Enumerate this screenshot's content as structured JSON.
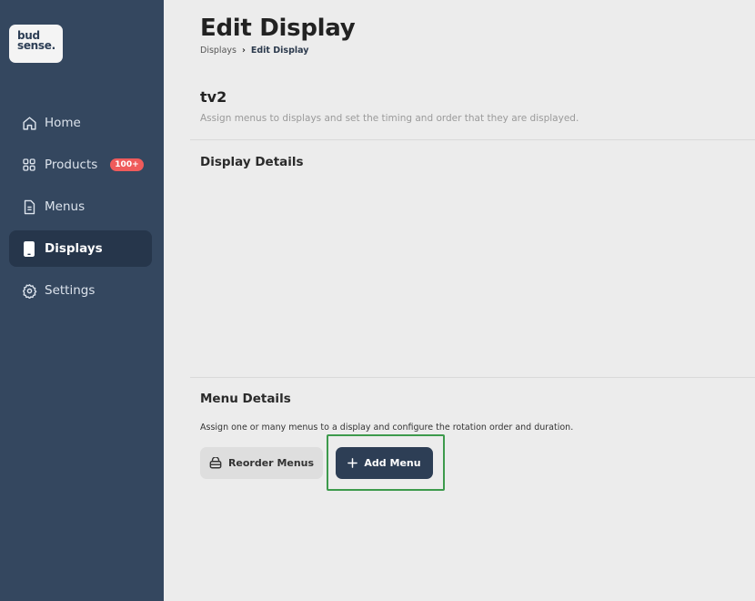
{
  "logo": {
    "line1": "bud",
    "line2": "sense."
  },
  "sidebar": {
    "items": [
      {
        "label": "Home",
        "icon": "home-icon"
      },
      {
        "label": "Products",
        "icon": "grid-icon",
        "badge": "100+"
      },
      {
        "label": "Menus",
        "icon": "document-icon"
      },
      {
        "label": "Displays",
        "icon": "display-icon",
        "active": true
      },
      {
        "label": "Settings",
        "icon": "gear-icon"
      }
    ]
  },
  "header": {
    "title": "Edit Display",
    "breadcrumb": {
      "parent": "Displays",
      "separator": "›",
      "current": "Edit Display"
    }
  },
  "display": {
    "name": "tv2",
    "description": "Assign menus to displays and set the timing and order that they are displayed."
  },
  "sections": {
    "display_details": "Display Details",
    "menu_details": "Menu Details",
    "menu_description": "Assign one or many menus to a display and configure the rotation order and duration."
  },
  "buttons": {
    "reorder": "Reorder Menus",
    "add": "Add Menu"
  },
  "colors": {
    "sidebar": "#34475f",
    "sidebar_active": "#26364b",
    "primary_button": "#2d3e55",
    "badge": "#ef5b5b",
    "highlight": "#3d9a4c"
  }
}
